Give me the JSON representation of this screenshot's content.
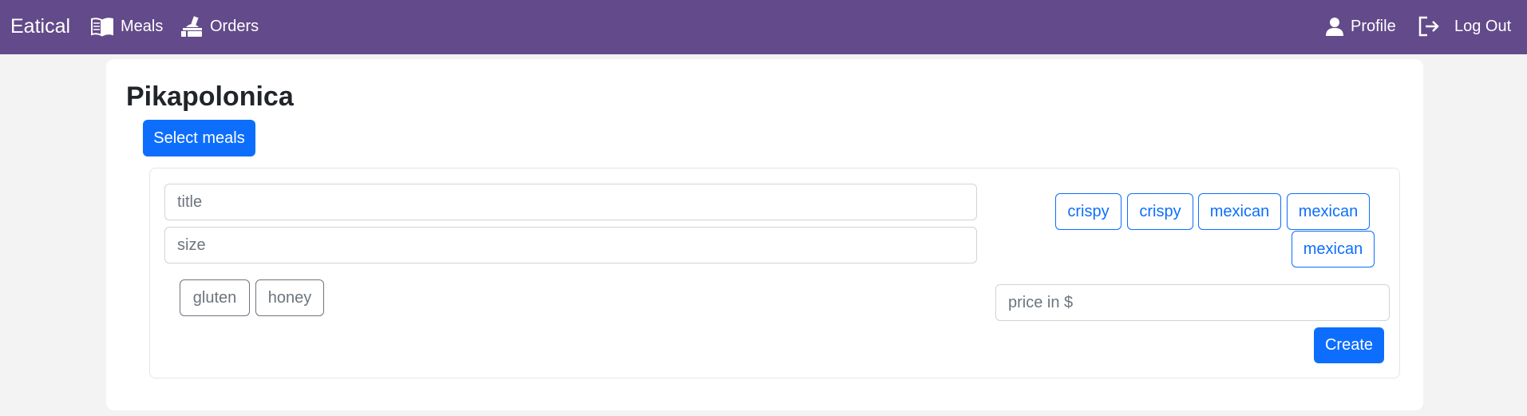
{
  "nav": {
    "brand": "Eatical",
    "meals_label": "Meals",
    "orders_label": "Orders",
    "profile_label": "Profile",
    "logout_label": "Log Out"
  },
  "restaurant": {
    "name": "Pikapolonica",
    "select_meals_label": "Select meals"
  },
  "form": {
    "title_placeholder": "title",
    "size_placeholder": "size",
    "price_placeholder": "price in $",
    "create_label": "Create",
    "ingredients": [
      "gluten",
      "honey"
    ],
    "tags": [
      "crispy",
      "crispy",
      "mexican",
      "mexican",
      "mexican"
    ]
  },
  "colors": {
    "navbar": "#634a8a",
    "primary": "#0d6efd",
    "secondary": "#6c757d",
    "background": "#f3f3f3"
  }
}
